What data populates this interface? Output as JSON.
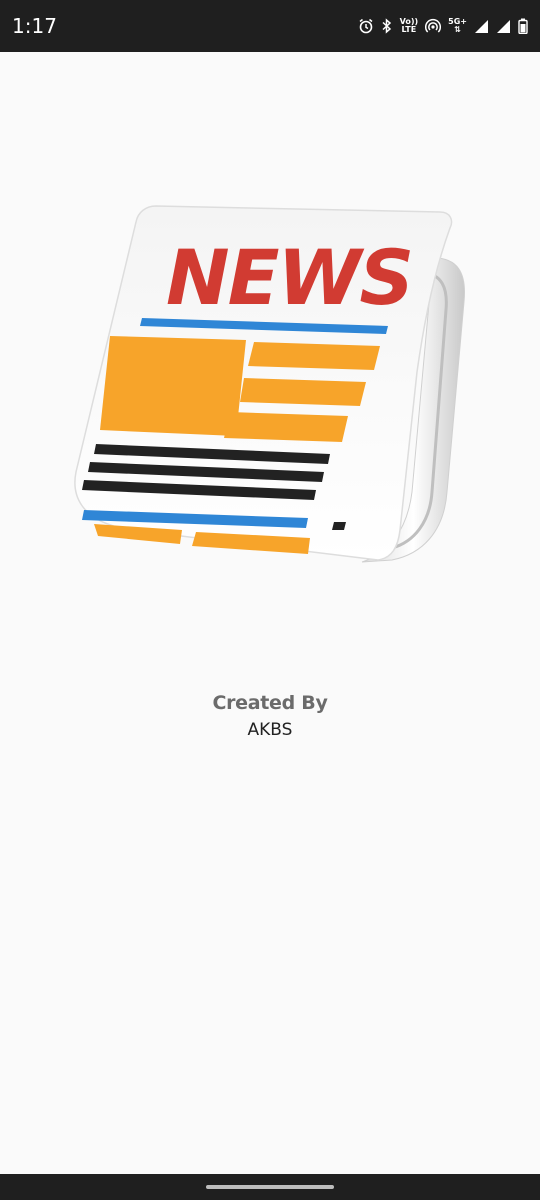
{
  "status_bar": {
    "time": "1:17",
    "icons": [
      "alarm-icon",
      "bluetooth-icon",
      "volte-icon",
      "hotspot-icon",
      "5g-signal-icon",
      "signal-icon",
      "battery-icon"
    ],
    "volte_top": "Vo))",
    "volte_bottom": "LTE",
    "network_label": "5G+"
  },
  "splash": {
    "logo_text": "NEWS",
    "credit_title": "Created By",
    "credit_name": "AKBS"
  },
  "colors": {
    "headline_red": "#d13b32",
    "stripe_blue": "#2f86d6",
    "block_orange": "#f7a42a",
    "line_black": "#222222",
    "status_bar": "#1f1f1f",
    "background": "#fafafa"
  }
}
